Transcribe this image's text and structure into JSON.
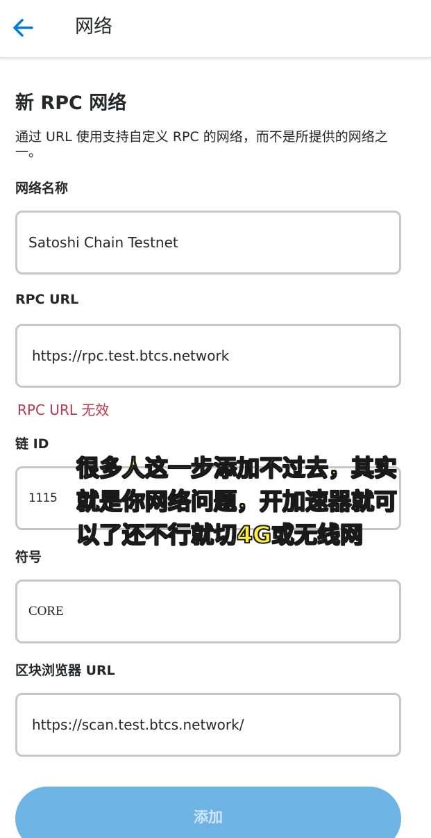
{
  "header": {
    "title": "网络",
    "back_icon": "arrow-left-icon"
  },
  "section": {
    "title": "新 RPC 网络",
    "description": "通过 URL 使用支持自定义 RPC 的网络，而不是所提供的网络之一。"
  },
  "fields": {
    "network_name": {
      "label": "网络名称",
      "value": "Satoshi Chain Testnet"
    },
    "rpc_url": {
      "label": "RPC URL",
      "value": "https://rpc.test.btcs.network",
      "error": "RPC URL 无效"
    },
    "chain_id": {
      "label": "链 ID",
      "value": "1115"
    },
    "symbol": {
      "label": "符号",
      "value": "CORE"
    },
    "explorer_url": {
      "label": "区块浏览器 URL",
      "value": "https://scan.test.btcs.network/"
    }
  },
  "overlay_caption": "很多人这一步添加不过去，其实就是你网络问题，开加速器就可以了还不行就切4G或无线网",
  "add_button": {
    "label": "添加"
  },
  "colors": {
    "accent": "#037dd6",
    "error": "#c0364a",
    "button_disabled": "#6db4e4",
    "caption_fill": "#fff13a"
  }
}
